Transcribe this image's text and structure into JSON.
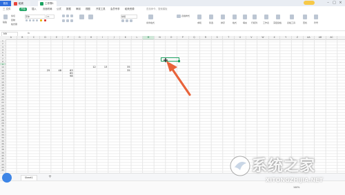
{
  "titlebar": {
    "tabs": [
      {
        "label": "首页"
      },
      {
        "label": "稻壳"
      },
      {
        "label": "工作簿1"
      }
    ],
    "login_label": "登录"
  },
  "menu": {
    "items": [
      "三 文件",
      "开始",
      "插入",
      "页面布局",
      "公式",
      "数据",
      "审阅",
      "视图",
      "开发工具",
      "会员专享",
      "稻壳资源"
    ],
    "search_placeholder": "查找命令、搜索模板"
  },
  "ribbon": {
    "groups": [
      "格式刷",
      "粘贴",
      "剪切",
      "复制",
      "宋体",
      "11",
      "常规",
      "条件格式",
      "表格样式",
      "求和",
      "筛选",
      "排序",
      "格式",
      "填充",
      "行和列",
      "工作表",
      "冻结窗格",
      "表格工具",
      "查找",
      "符号"
    ]
  },
  "formula_bar": {
    "name_box": "M9",
    "fx": "fx"
  },
  "columns": [
    "A",
    "B",
    "C",
    "D",
    "E",
    "F",
    "G",
    "H",
    "I",
    "J",
    "K",
    "L",
    "M",
    "N",
    "O",
    "P",
    "Q",
    "R",
    "S",
    "T",
    "U",
    "V",
    "W",
    "X",
    "Y",
    "Z",
    "AA",
    "AB",
    "AC"
  ],
  "rows": [
    "1",
    "2",
    "3",
    "4",
    "5",
    "6",
    "7",
    "8",
    "9",
    "10",
    "11",
    "12",
    "13",
    "14",
    "15",
    "16",
    "17",
    "18",
    "19",
    "20",
    "21",
    "22",
    "23",
    "24",
    "25",
    "26",
    "27",
    "28",
    "29",
    "30",
    "31",
    "32",
    "33",
    "34",
    "35",
    "36",
    "37",
    "38",
    "39",
    "40",
    "41",
    "42",
    "43",
    "44",
    "45"
  ],
  "cells": [
    {
      "value": "12",
      "col": "H",
      "row": "10"
    },
    {
      "value": "13",
      "col": "I",
      "row": "10"
    },
    {
      "value": "35",
      "col": "K",
      "row": "10"
    },
    {
      "value": "25",
      "col": "D",
      "row": "11"
    },
    {
      "value": "48",
      "col": "E",
      "row": "11"
    },
    {
      "value": "63",
      "col": "F",
      "row": "11"
    },
    {
      "value": "35",
      "col": "K",
      "row": "11"
    },
    {
      "value": "65",
      "col": "F",
      "row": "12"
    },
    {
      "value": "98",
      "col": "F",
      "row": "13"
    }
  ],
  "selected_cell": "M9",
  "sheet_tab": "Sheet1",
  "zoom": "100%",
  "watermark": {
    "text": "系统之家",
    "url": "XITONGZHIJIA.NET"
  },
  "colors": {
    "accent": "#1aa260",
    "arrow": "#e8633a",
    "home_tab": "#2f6fde"
  }
}
